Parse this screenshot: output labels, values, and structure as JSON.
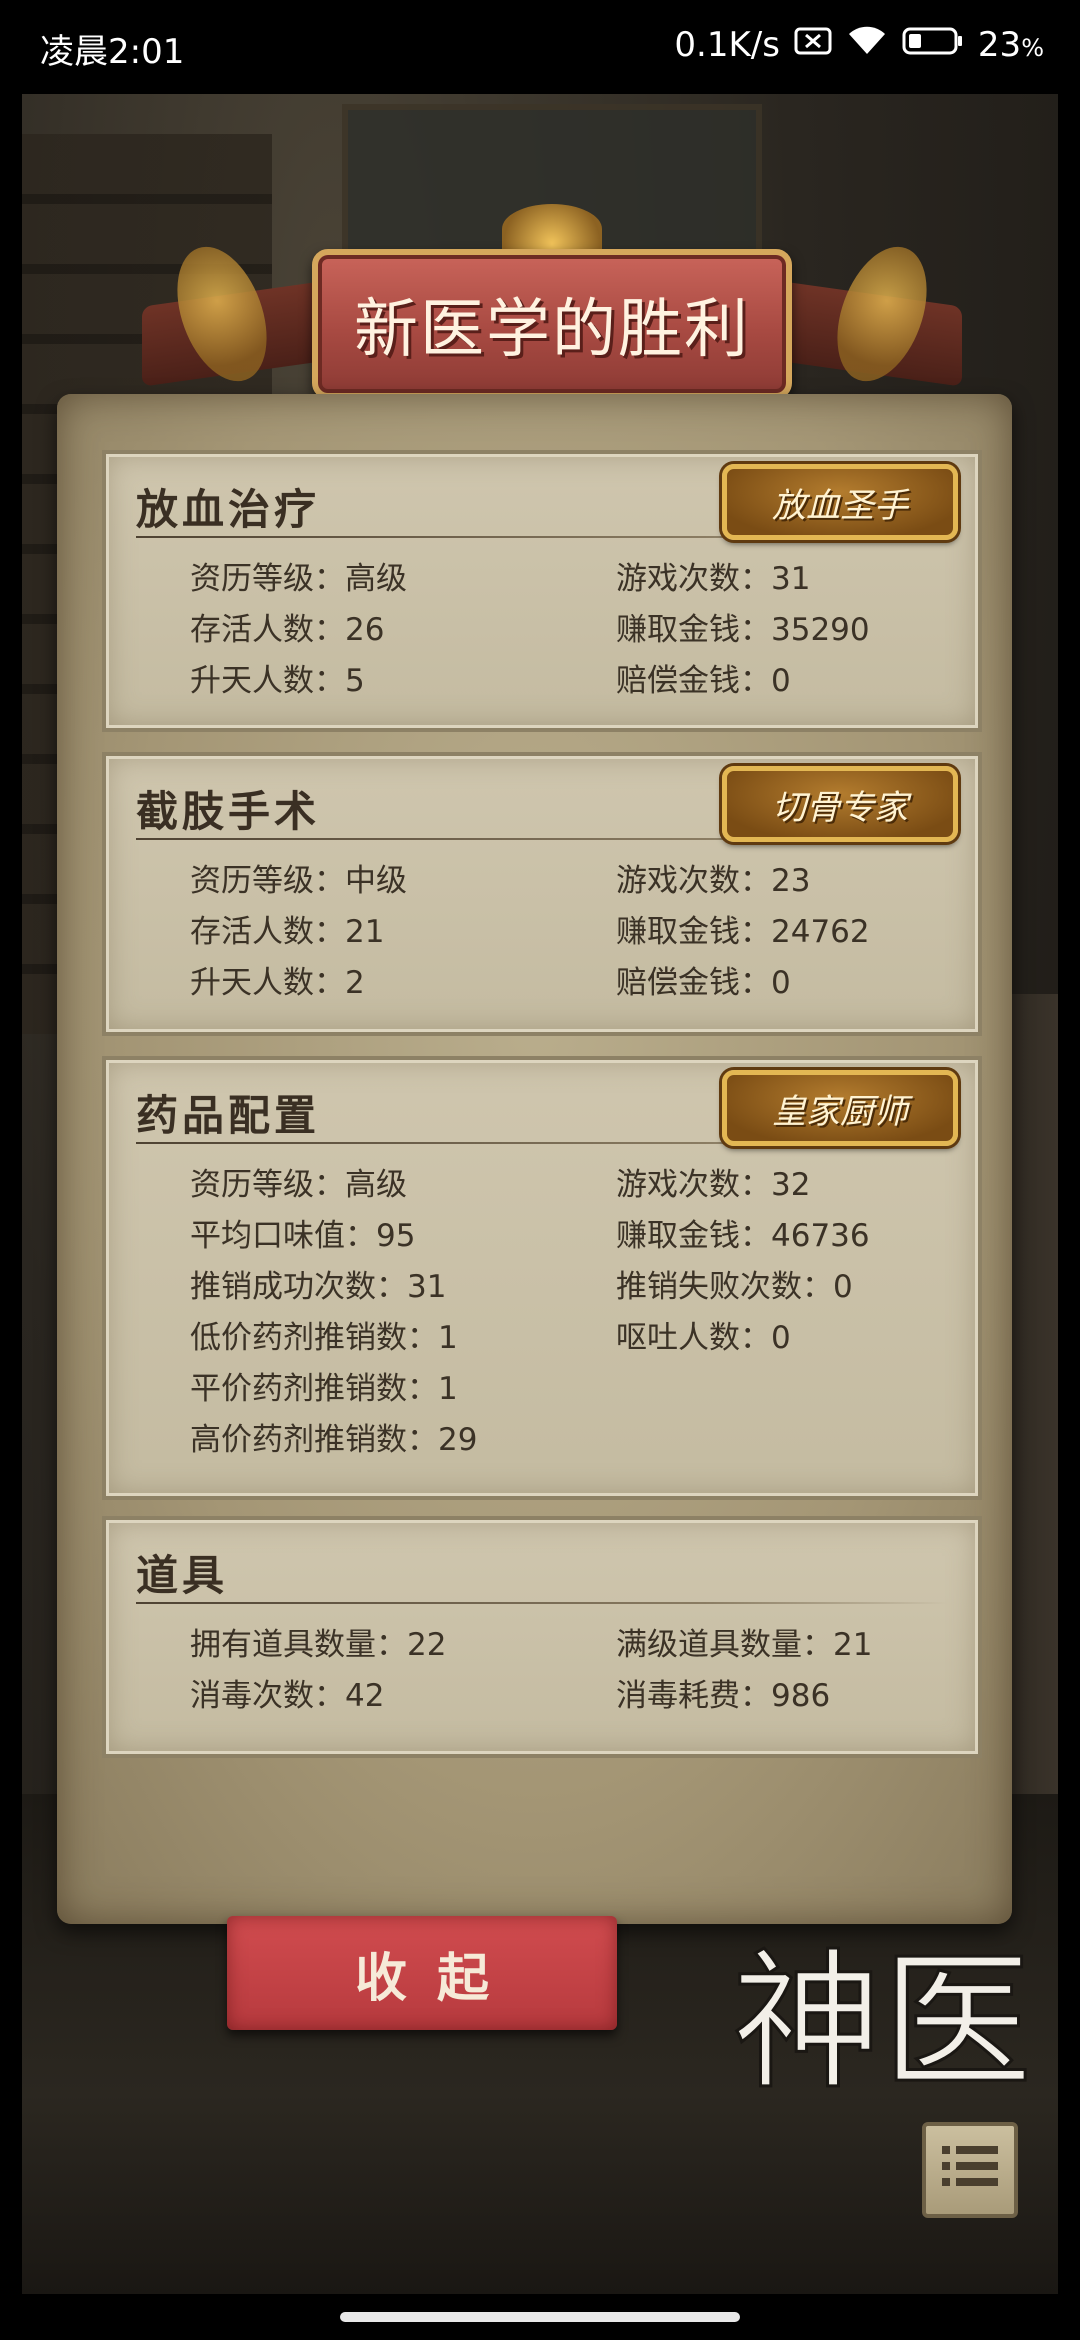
{
  "status_bar": {
    "time": "凌晨2:01",
    "network_speed": "0.1K/s",
    "battery": "23",
    "battery_unit": "%",
    "icons": [
      "sim-disabled-icon",
      "wifi-icon",
      "battery-icon"
    ]
  },
  "banner": {
    "title": "新医学的胜利"
  },
  "sections": [
    {
      "title": "放血治疗",
      "badge": "放血圣手",
      "stats": [
        "资历等级：高级",
        "游戏次数：31",
        "存活人数：26",
        "赚取金钱：35290",
        "升天人数：5",
        "赔偿金钱：0"
      ]
    },
    {
      "title": "截肢手术",
      "badge": "切骨专家",
      "stats": [
        "资历等级：中级",
        "游戏次数：23",
        "存活人数：21",
        "赚取金钱：24762",
        "升天人数：2",
        "赔偿金钱：0"
      ]
    },
    {
      "title": "药品配置",
      "badge": "皇家厨师",
      "stats": [
        "资历等级：高级",
        "游戏次数：32",
        "平均口味值：95",
        "赚取金钱：46736",
        "推销成功次数：31",
        "推销失败次数：0",
        "低价药剂推销数：1",
        "呕吐人数：0",
        "平价药剂推销数：1",
        "",
        "高价药剂推销数：29",
        ""
      ]
    },
    {
      "title": "道具",
      "badge": "",
      "stats": [
        "拥有道具数量：22",
        "满级道具数量：21",
        "消毒次数：42",
        "消毒耗费：986"
      ]
    }
  ],
  "buttons": {
    "collapse": "收起"
  },
  "logo_text": "神医",
  "colors": {
    "banner_red": "#a84a42",
    "badge_gold": "#e3b753",
    "button_red": "#c5434a",
    "parchment": "#c4bba1",
    "text_brown": "#3b3226"
  }
}
